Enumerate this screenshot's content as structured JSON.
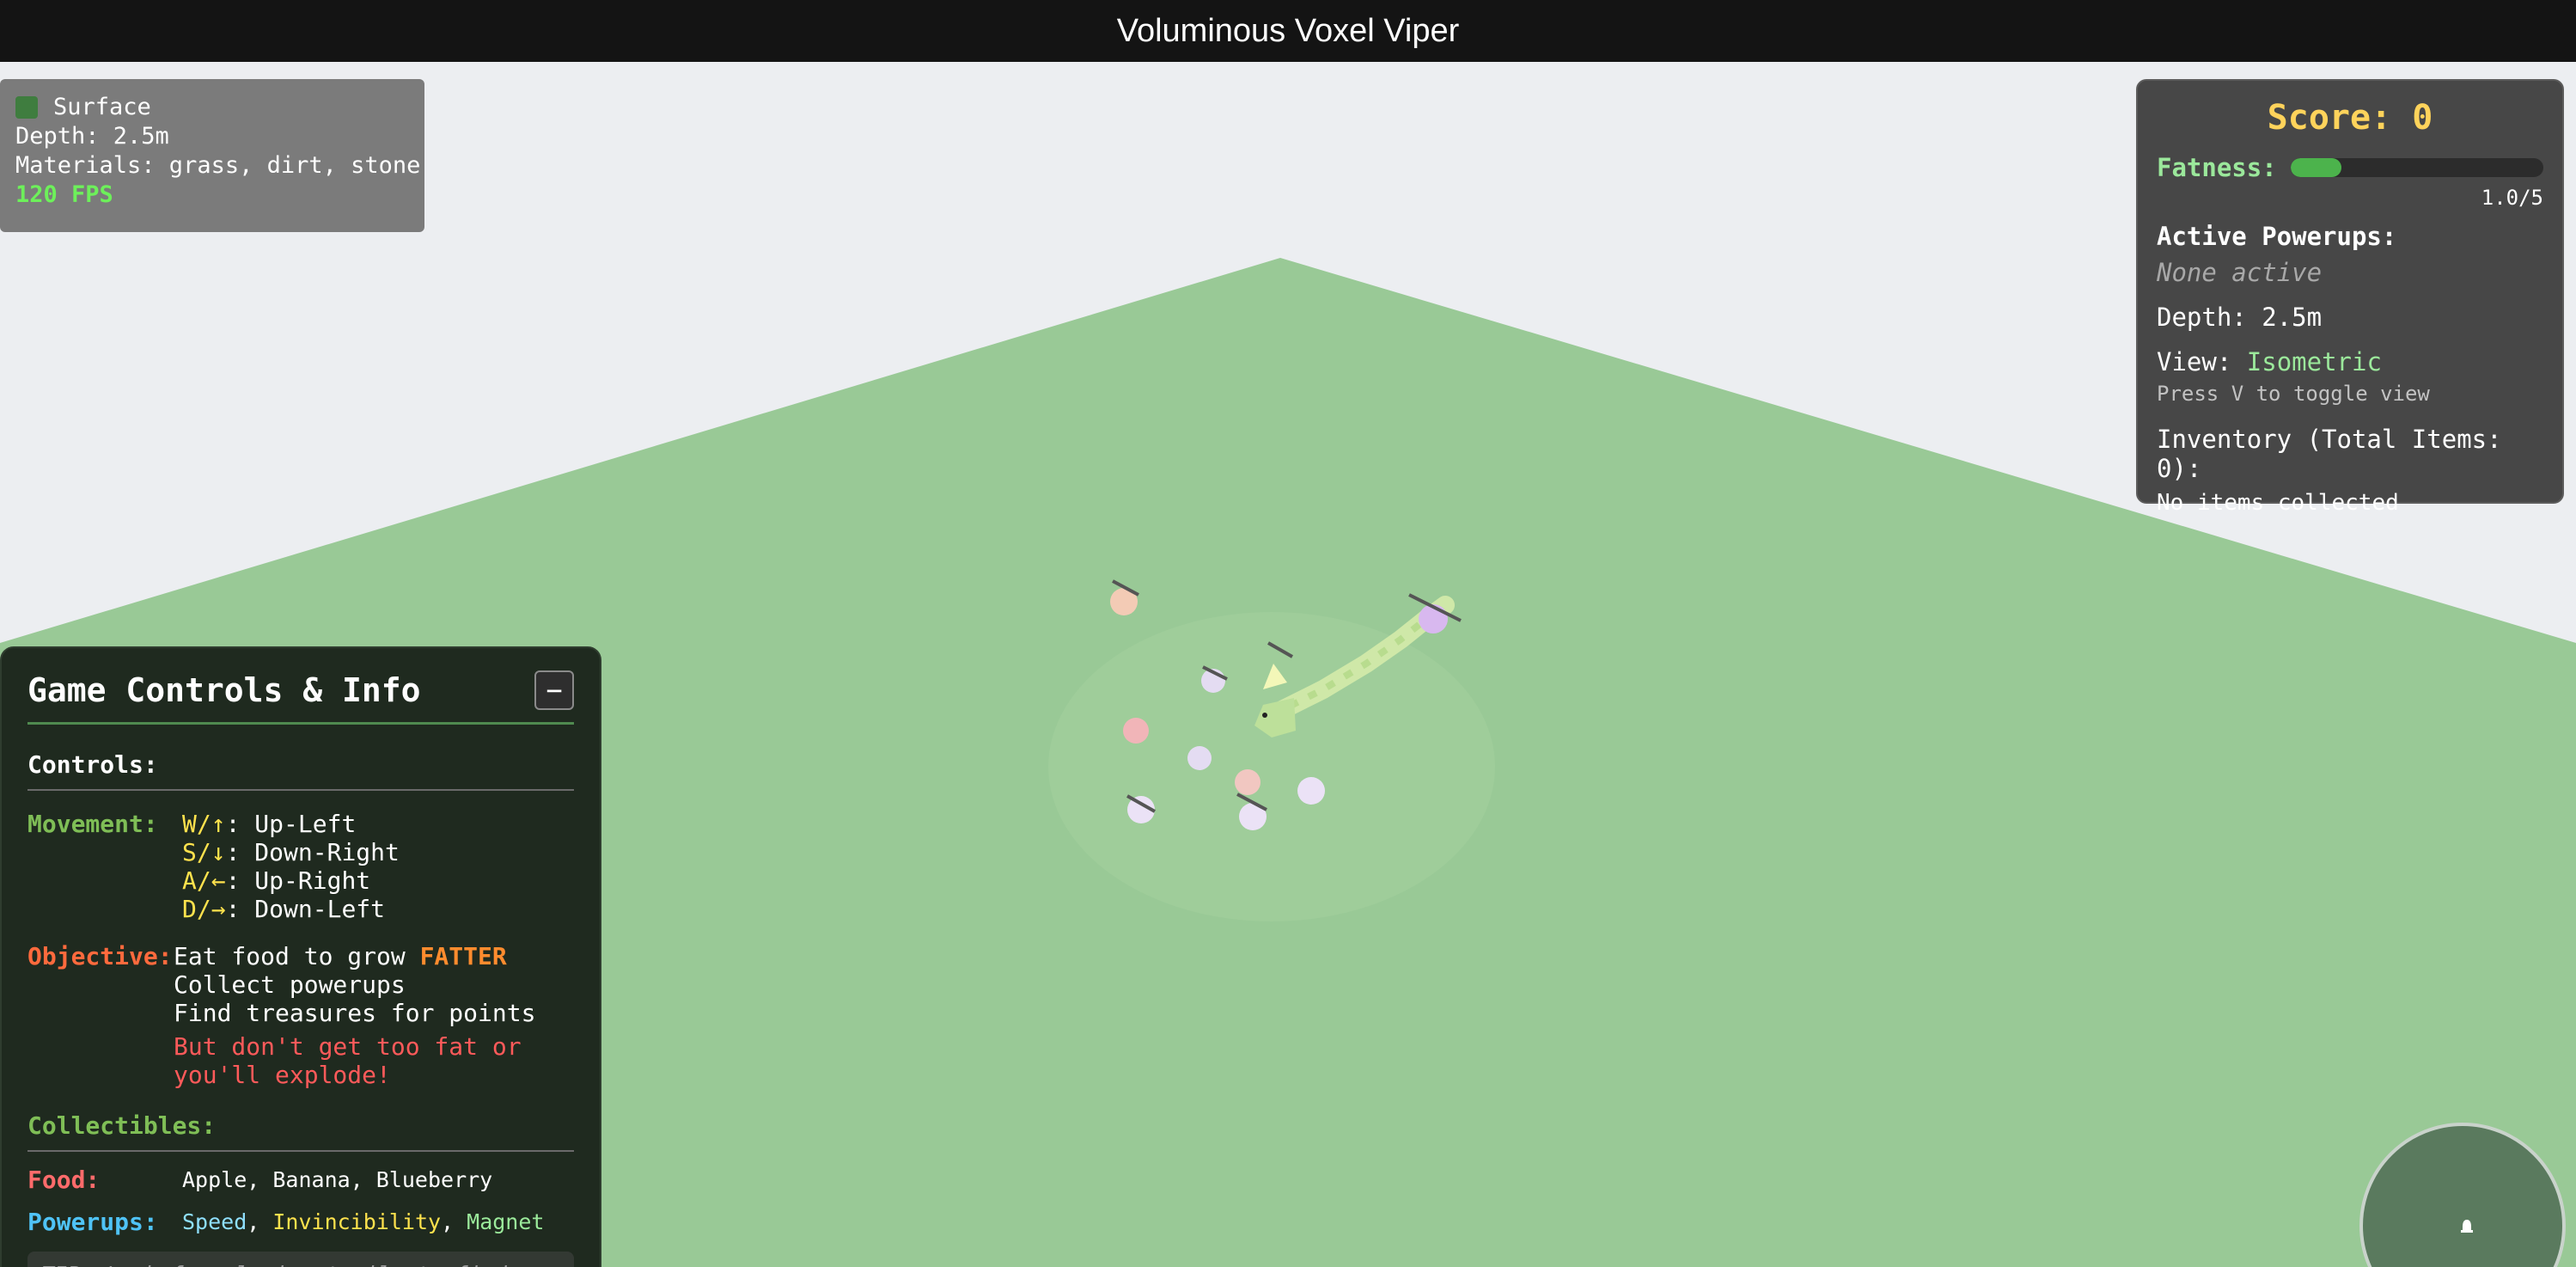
{
  "window": {
    "title": "Voluminous Voxel Viper"
  },
  "debug": {
    "layer": "Surface",
    "depth": "Depth: 2.5m",
    "materials": "Materials: grass, dirt, stone",
    "fps": "120 FPS",
    "layer_color": "#3f7d3f"
  },
  "stats": {
    "score": "Score: 0",
    "fatness_label": "Fatness:",
    "fatness_value": "1.0/5",
    "fatness_fraction": 0.2,
    "powerups_title": "Active Powerups:",
    "powerups_empty": "None active",
    "depth": "Depth: 2.5m",
    "view_label": "View:",
    "view_value": "Isometric",
    "view_hint": "Press V to toggle view",
    "inventory_title": "Inventory (Total Items: 0):",
    "inventory_empty": "No items collected"
  },
  "controls": {
    "title": "Game Controls & Info",
    "collapse_label": "−",
    "controls_heading": "Controls:",
    "movement_label": "Movement:",
    "movement": [
      {
        "key": "W/↑",
        "action": ": Up-Left"
      },
      {
        "key": "S/↓",
        "action": ": Down-Right"
      },
      {
        "key": "A/←",
        "action": ": Up-Right"
      },
      {
        "key": "D/→",
        "action": ": Down-Left"
      }
    ],
    "objective_label": "Objective:",
    "objective_line1_prefix": "Eat food to grow ",
    "objective_line1_emph": "FATTER",
    "objective_line2": "Collect powerups",
    "objective_line3": "Find treasures for points",
    "objective_warning": "But don't get too fat or you'll explode!",
    "collectibles_heading": "Collectibles:",
    "food_label": "Food:",
    "food_items": "Apple, Banana, Blueberry",
    "powerups_label": "Powerups:",
    "powerup_speed": "Speed",
    "powerup_invincibility": "Invincibility",
    "powerup_magnet": "Magnet",
    "separator": ", ",
    "tip": "TIP: Look for glowing trails to find your"
  },
  "scene": {
    "sky_color": "#eceef1",
    "ground_color": "#99c996",
    "snake_color": "#cfe8a8"
  }
}
